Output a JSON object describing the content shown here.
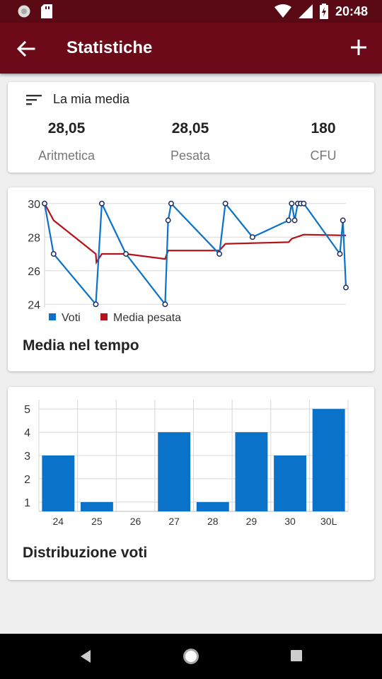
{
  "status_bar": {
    "time": "20:48"
  },
  "app_bar": {
    "title": "Statistiche"
  },
  "media": {
    "header": "La mia media",
    "stats": [
      {
        "value": "28,05",
        "label": "Aritmetica"
      },
      {
        "value": "28,05",
        "label": "Pesata"
      },
      {
        "value": "180",
        "label": "CFU"
      }
    ]
  },
  "colors": {
    "primary": "#6d0a1a",
    "status_bar": "#5a0a14",
    "series_voti": "#0a72c9",
    "series_media": "#b5121b"
  },
  "chart_data": [
    {
      "type": "line",
      "title": "Media nel tempo",
      "ylim": [
        23.8,
        30.2
      ],
      "yticks": [
        24,
        26,
        28,
        30
      ],
      "grid": true,
      "legend": "bottom-left",
      "series": [
        {
          "name": "Voti",
          "x": [
            0,
            3,
            17,
            19,
            27,
            40,
            41,
            42,
            58,
            60,
            69,
            81,
            82,
            83,
            84,
            85,
            86,
            98,
            99,
            100
          ],
          "values": [
            30,
            27,
            24,
            30,
            27,
            24,
            29,
            30,
            27,
            30,
            28,
            29,
            30,
            29,
            30,
            30,
            30,
            27,
            29,
            25
          ]
        },
        {
          "name": "Media pesata",
          "x": [
            0,
            3,
            17,
            17.2,
            19,
            27,
            40,
            41,
            58,
            60,
            81,
            82,
            86,
            100
          ],
          "values": [
            30,
            29,
            27,
            26.5,
            27,
            27,
            26.7,
            27.2,
            27.2,
            27.6,
            27.7,
            27.9,
            28.15,
            28.1
          ]
        }
      ]
    },
    {
      "type": "bar",
      "title": "Distribuzione voti",
      "categories": [
        "24",
        "25",
        "26",
        "27",
        "28",
        "29",
        "30",
        "30L"
      ],
      "values": [
        3,
        1,
        0,
        4,
        1,
        4,
        3,
        5
      ],
      "ylim": [
        0.6,
        5.4
      ],
      "yticks": [
        1,
        2,
        3,
        4,
        5
      ],
      "grid": true
    }
  ]
}
